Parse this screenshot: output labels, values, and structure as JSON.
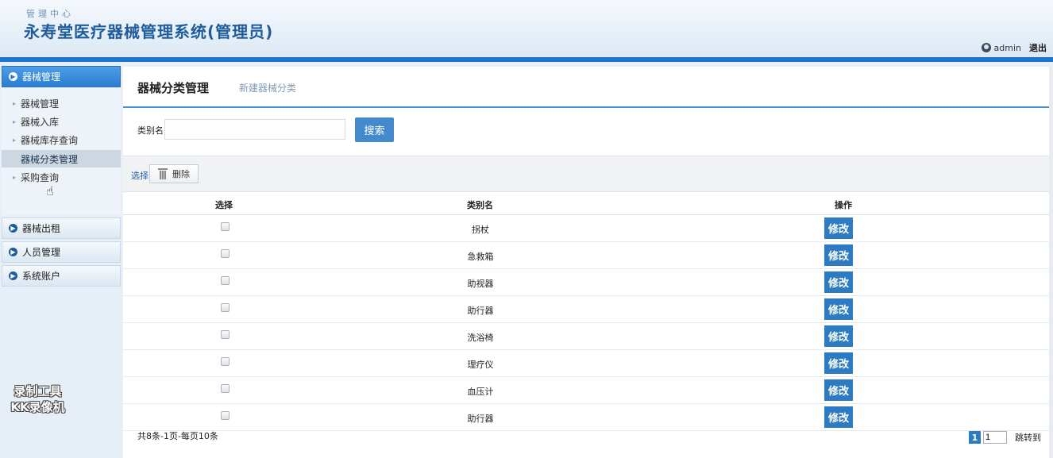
{
  "header": {
    "subtitle": "管理中心",
    "title": "永寿堂医疗器械管理系统(管理员)",
    "username": "admin",
    "logout": "退出"
  },
  "sidebar": {
    "sections": [
      {
        "label": "器械管理",
        "icon": "arrow-circle-icon",
        "active": true
      },
      {
        "label": "器械出租",
        "icon": "arrow-circle-icon"
      },
      {
        "label": "人员管理",
        "icon": "arrow-circle-icon"
      },
      {
        "label": "系统账户",
        "icon": "arrow-circle-icon"
      }
    ],
    "items": [
      {
        "label": "器械管理"
      },
      {
        "label": "器械入库"
      },
      {
        "label": "器械库存查询"
      },
      {
        "label": "器械分类管理",
        "active": true
      },
      {
        "label": "采购查询"
      }
    ],
    "watermark": [
      "录制工具",
      "KK录像机"
    ]
  },
  "tabs": {
    "active": "器械分类管理",
    "link": "新建器械分类"
  },
  "search": {
    "label": "类别名",
    "value": "",
    "button": "搜索"
  },
  "toolbar": {
    "select": "选择",
    "delete": "删除"
  },
  "table": {
    "columns": [
      "选择",
      "类别名",
      "操作"
    ],
    "rows": [
      {
        "name": "拐杖",
        "action": "修改"
      },
      {
        "name": "急救箱",
        "action": "修改"
      },
      {
        "name": "助视器",
        "action": "修改"
      },
      {
        "name": "助行器",
        "action": "修改"
      },
      {
        "name": "洗浴椅",
        "action": "修改"
      },
      {
        "name": "理疗仪",
        "action": "修改"
      },
      {
        "name": "血压计",
        "action": "修改"
      },
      {
        "name": "助行器",
        "action": "修改"
      }
    ]
  },
  "pagination": {
    "info": "共8条-1页-每页10条",
    "current": "1",
    "input": "1",
    "jump": "跳转到"
  },
  "colors": {
    "accent": "#2d7cc3",
    "header_bar": "#1c74cc"
  }
}
